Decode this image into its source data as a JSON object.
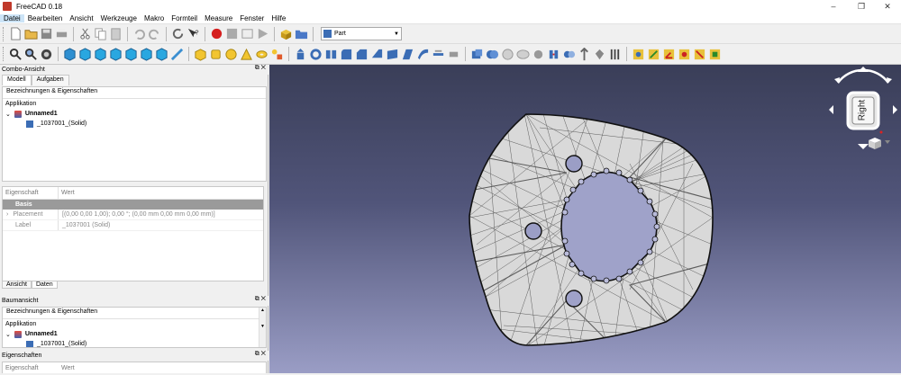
{
  "window": {
    "title": "FreeCAD 0.18",
    "minimize": "–",
    "restore": "❐",
    "close": "✕"
  },
  "menu": [
    "Datei",
    "Bearbeiten",
    "Ansicht",
    "Werkzeuge",
    "Makro",
    "Formteil",
    "Measure",
    "Fenster",
    "Hilfe"
  ],
  "workbench": {
    "selected": "Part"
  },
  "combo_view": {
    "title": "Combo-Ansicht",
    "tabs": [
      "Modell",
      "Aufgaben"
    ],
    "labels_header": "Bezeichnungen & Eigenschaften",
    "section": "Applikation",
    "document": "Unnamed1",
    "object": "_1037001_(Solid)"
  },
  "property_grid": {
    "col_property": "Eigenschaft",
    "col_value": "Wert",
    "group": "Basis",
    "rows": [
      {
        "name": "Placement",
        "value": "[(0,00 0,00 1,00); 0,00 °; (0,00 mm  0,00 mm  0,00 mm)]"
      },
      {
        "name": "Label",
        "value": "_1037001 (Solid)"
      }
    ],
    "tabs": [
      "Ansicht",
      "Daten"
    ]
  },
  "tree_view": {
    "title": "Baumansicht",
    "labels_header": "Bezeichnungen & Eigenschaften",
    "section": "Applikation",
    "document": "Unnamed1",
    "object": "_1037001_(Solid)"
  },
  "properties_dock": {
    "title": "Eigenschaften",
    "col_property": "Eigenschaft",
    "col_value": "Wert"
  },
  "navcube": {
    "face": "Right"
  },
  "colors": {
    "viewport_top": "#3a3e58",
    "viewport_bottom": "#9a9dc5",
    "mesh_fill": "#d9d9d9",
    "mesh_line": "#1a1a1a"
  }
}
